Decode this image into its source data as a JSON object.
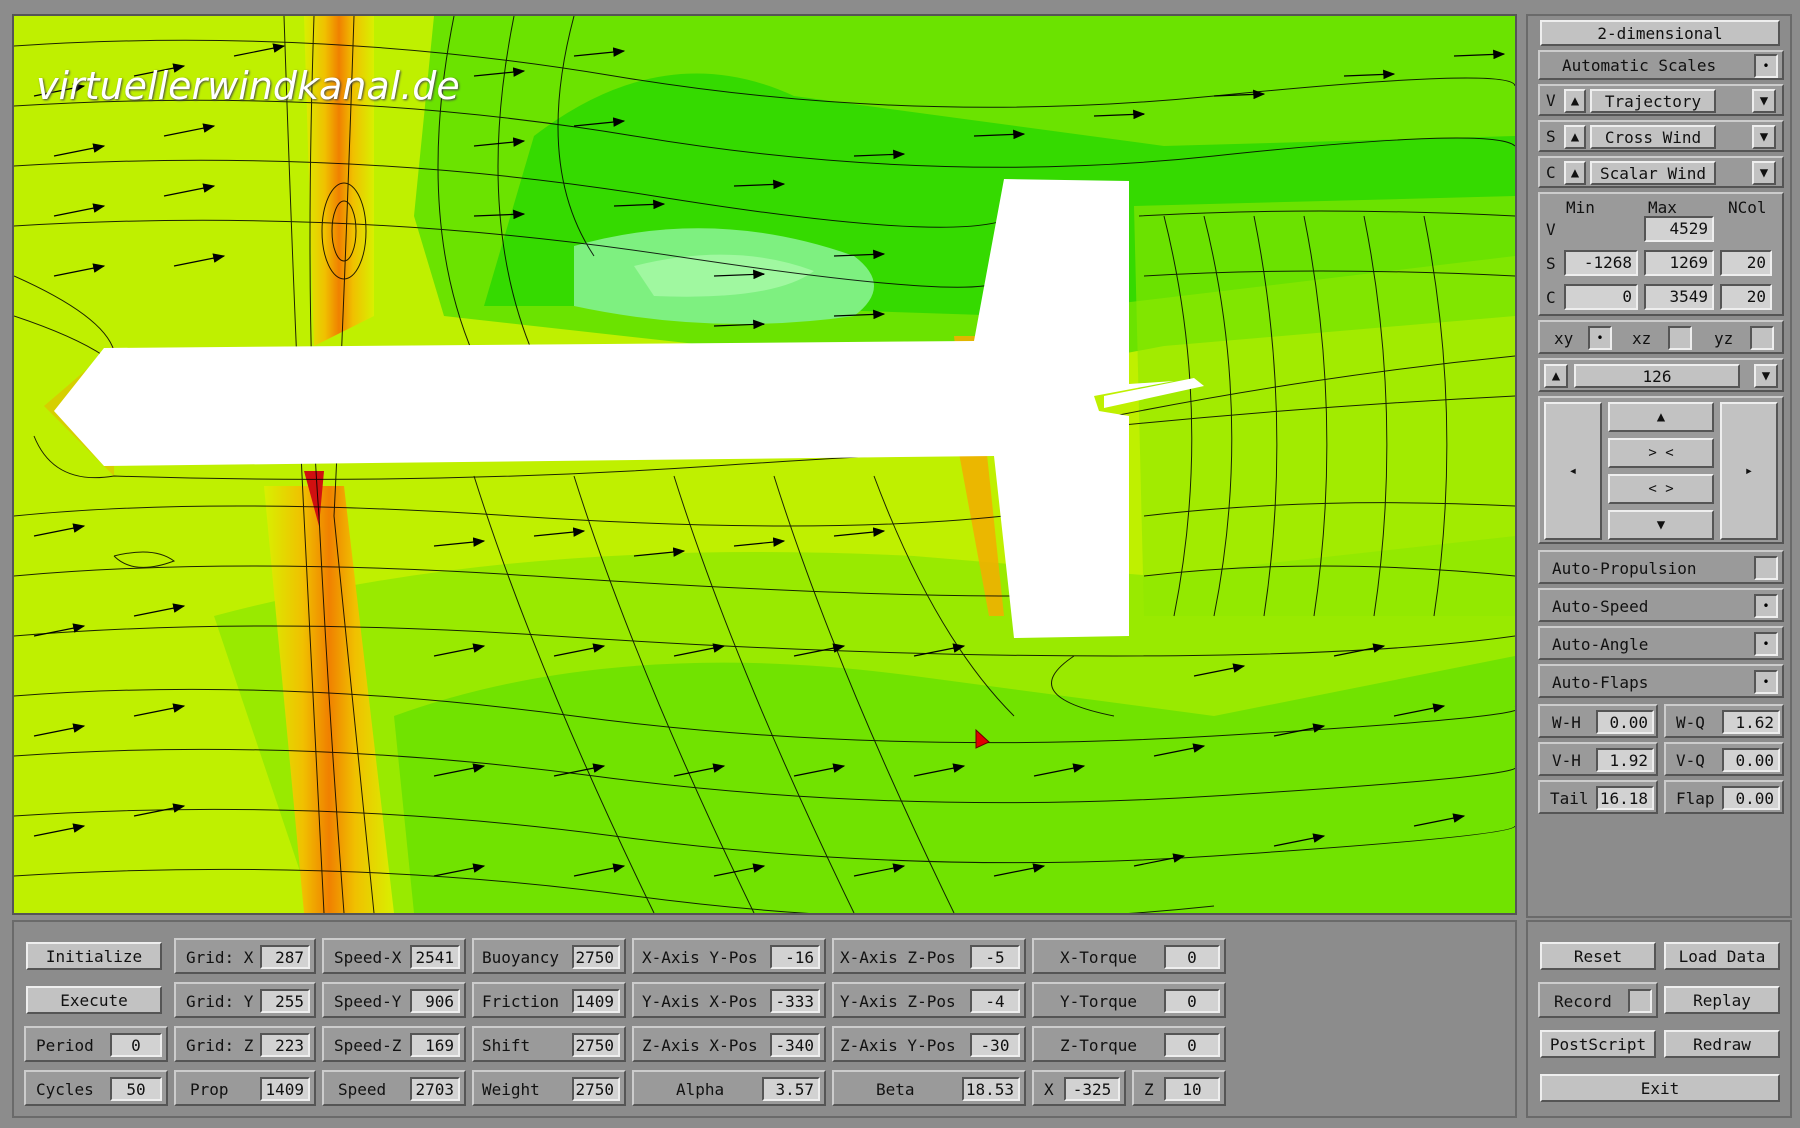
{
  "watermark": "virtuellerwindkanal.de",
  "right_panel": {
    "mode_button": "2-dimensional",
    "scales_button": "Automatic Scales",
    "rows": [
      {
        "key": "V",
        "select": "Trajectory"
      },
      {
        "key": "S",
        "select": "Cross Wind"
      },
      {
        "key": "C",
        "select": "Scalar Wind"
      }
    ],
    "scale_headers": {
      "min": "Min",
      "max": "Max",
      "ncol": "NCol"
    },
    "scales": {
      "v": {
        "label": "V",
        "max": "4529"
      },
      "s": {
        "label": "S",
        "min": "-1268",
        "max": "1269",
        "ncol": "20"
      },
      "c": {
        "label": "C",
        "min": "0",
        "max": "3549",
        "ncol": "20"
      }
    },
    "planes": {
      "xy": "xy",
      "xz": "xz",
      "yz": "yz"
    },
    "slice": "126",
    "nav": {
      "up": "▲",
      "zoom_in": "> <",
      "zoom_out": "< >",
      "down": "▼",
      "left": "◂",
      "right": "▸"
    },
    "toggles": {
      "auto_propulsion": "Auto-Propulsion",
      "auto_speed": "Auto-Speed",
      "auto_angle": "Auto-Angle",
      "auto_flaps": "Auto-Flaps"
    },
    "params": {
      "wh": {
        "label": "W-H",
        "value": "0.00"
      },
      "wq": {
        "label": "W-Q",
        "value": "1.62"
      },
      "vh": {
        "label": "V-H",
        "value": "1.92"
      },
      "vq": {
        "label": "V-Q",
        "value": "0.00"
      },
      "tail": {
        "label": "Tail",
        "value": "16.18"
      },
      "flap": {
        "label": "Flap",
        "value": "0.00"
      }
    }
  },
  "bottom": {
    "initialize": "Initialize",
    "execute": "Execute",
    "period": {
      "label": "Period",
      "value": "0"
    },
    "cycles": {
      "label": "Cycles",
      "value": "50"
    },
    "grid_x": {
      "label": "Grid: X",
      "value": "287"
    },
    "grid_y": {
      "label": "Grid: Y",
      "value": "255"
    },
    "grid_z": {
      "label": "Grid: Z",
      "value": "223"
    },
    "prop": {
      "label": "Prop",
      "value": "1409"
    },
    "speed_x": {
      "label": "Speed-X",
      "value": "2541"
    },
    "speed_y": {
      "label": "Speed-Y",
      "value": "906"
    },
    "speed_z": {
      "label": "Speed-Z",
      "value": "169"
    },
    "speed": {
      "label": "Speed",
      "value": "2703"
    },
    "buoyancy": {
      "label": "Buoyancy",
      "value": "2750"
    },
    "friction": {
      "label": "Friction",
      "value": "1409"
    },
    "shift": {
      "label": "Shift",
      "value": "2750"
    },
    "weight": {
      "label": "Weight",
      "value": "2750"
    },
    "xaxis_ypos": {
      "label": "X-Axis Y-Pos",
      "value": "-16"
    },
    "yaxis_xpos": {
      "label": "Y-Axis X-Pos",
      "value": "-333"
    },
    "zaxis_xpos": {
      "label": "Z-Axis X-Pos",
      "value": "-340"
    },
    "alpha": {
      "label": "Alpha",
      "value": "3.57"
    },
    "xaxis_zpos": {
      "label": "X-Axis Z-Pos",
      "value": "-5"
    },
    "yaxis_zpos": {
      "label": "Y-Axis Z-Pos",
      "value": "-4"
    },
    "zaxis_ypos": {
      "label": "Z-Axis Y-Pos",
      "value": "-30"
    },
    "beta": {
      "label": "Beta",
      "value": "18.53"
    },
    "xtorque": {
      "label": "X-Torque",
      "value": "0"
    },
    "ytorque": {
      "label": "Y-Torque",
      "value": "0"
    },
    "ztorque": {
      "label": "Z-Torque",
      "value": "0"
    },
    "x": {
      "label": "X",
      "value": "-325"
    },
    "z": {
      "label": "Z",
      "value": "10"
    }
  },
  "bottom_right": {
    "reset": "Reset",
    "load_data": "Load Data",
    "record": "Record",
    "replay": "Replay",
    "postscript": "PostScript",
    "redraw": "Redraw",
    "exit": "Exit"
  },
  "colors": {
    "field_green": "#3cdc00",
    "field_yellow": "#c8f000",
    "field_orange": "#f0a000",
    "field_red": "#e02000"
  }
}
